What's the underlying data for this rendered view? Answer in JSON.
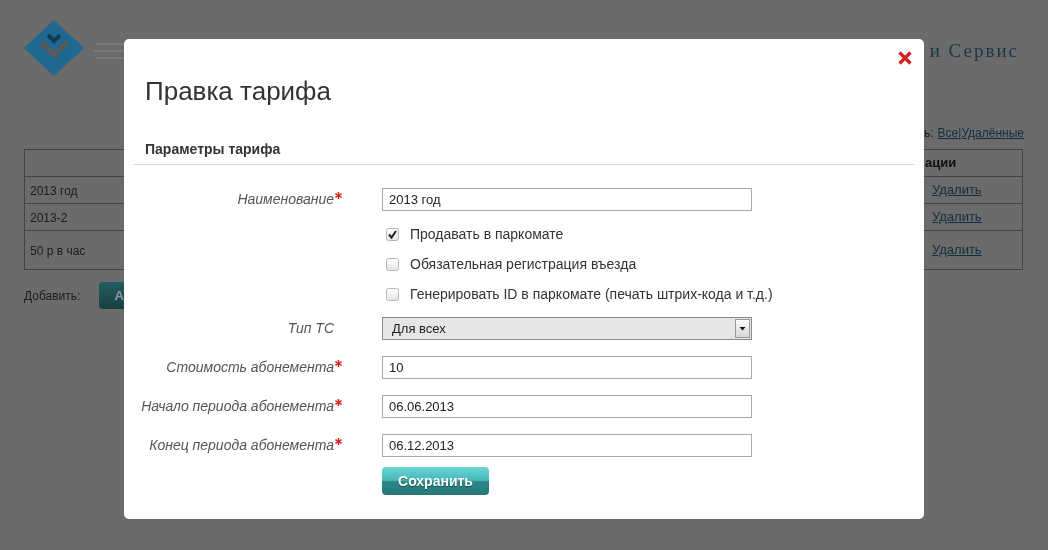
{
  "page": {
    "header_text": "и Сервис",
    "filter": {
      "label": "ь:",
      "links": [
        {
          "label": "Все"
        },
        {
          "label": "Удалённые"
        }
      ],
      "separator": "|"
    },
    "table": {
      "column_2_header": "ации",
      "rows": [
        {
          "column_1": "2013 год",
          "action": "Удалить"
        },
        {
          "column_1": "2013-2",
          "action": "Удалить"
        },
        {
          "column_1": "50 р в час",
          "action": "Удалить"
        }
      ]
    },
    "add": {
      "label": "Добавить:",
      "button": "А"
    }
  },
  "dialog": {
    "title": "Правка тарифа",
    "section": "Параметры тарифа",
    "fields": [
      {
        "kind": "text",
        "label": "Наименование",
        "required": true,
        "value": "2013 год"
      },
      {
        "kind": "checkbox",
        "label": "Продавать в паркомате",
        "checked": true
      },
      {
        "kind": "checkbox",
        "label": "Обязательная регистрация въезда",
        "checked": false
      },
      {
        "kind": "checkbox",
        "label": "Генерировать ID в паркомате (печать штрих-кода и т.д.)",
        "checked": false
      },
      {
        "kind": "select",
        "label": "Тип ТС",
        "required": false,
        "value": "Для всех"
      },
      {
        "kind": "text",
        "label": "Стоимость абонемента",
        "required": true,
        "value": "10"
      },
      {
        "kind": "text",
        "label": "Начало периода абонемента",
        "required": true,
        "value": "06.06.2013"
      },
      {
        "kind": "text",
        "label": "Конец периода абонемента",
        "required": true,
        "value": "06.12.2013"
      }
    ],
    "save_button": "Сохранить"
  }
}
